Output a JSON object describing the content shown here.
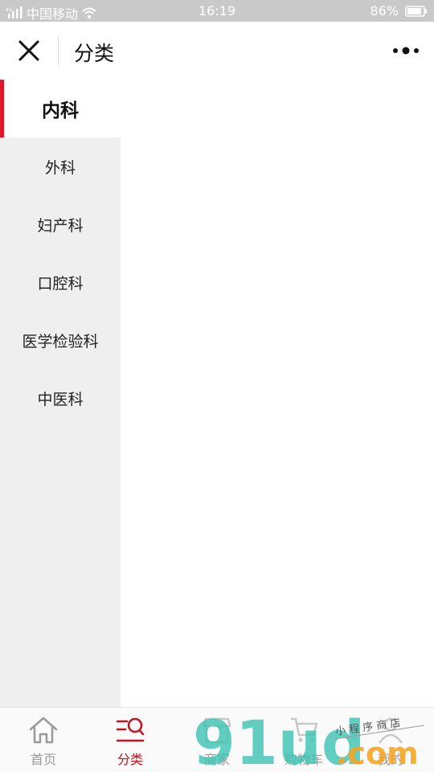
{
  "status_bar": {
    "carrier": "中国移动",
    "time": "16:19",
    "battery": "86%"
  },
  "nav": {
    "title": "分类",
    "close_icon": "close-icon",
    "more_icon": "more-dots-icon"
  },
  "categories": [
    {
      "label": "内科",
      "active": true
    },
    {
      "label": "外科",
      "active": false
    },
    {
      "label": "妇产科",
      "active": false
    },
    {
      "label": "口腔科",
      "active": false
    },
    {
      "label": "医学检验科",
      "active": false
    },
    {
      "label": "中医科",
      "active": false
    }
  ],
  "tabs": [
    {
      "label": "首页",
      "icon": "home-icon",
      "active": false
    },
    {
      "label": "分类",
      "icon": "category-search-icon",
      "active": true
    },
    {
      "label": "商家",
      "icon": "store-icon",
      "active": false
    },
    {
      "label": "购物车",
      "icon": "cart-icon",
      "active": false
    },
    {
      "label": "我的",
      "icon": "user-icon",
      "active": false
    }
  ],
  "watermark": {
    "logo_text": "91ud",
    "domain": ".com",
    "slogan": "小程序商店"
  },
  "colors": {
    "accent": "#e0162b",
    "active_tab": "#c0141f",
    "sidebar_bg": "#efefef",
    "status_bar_bg": "#c9c9c9",
    "watermark_teal": "#3cc3b3",
    "watermark_orange": "#f5a623"
  }
}
